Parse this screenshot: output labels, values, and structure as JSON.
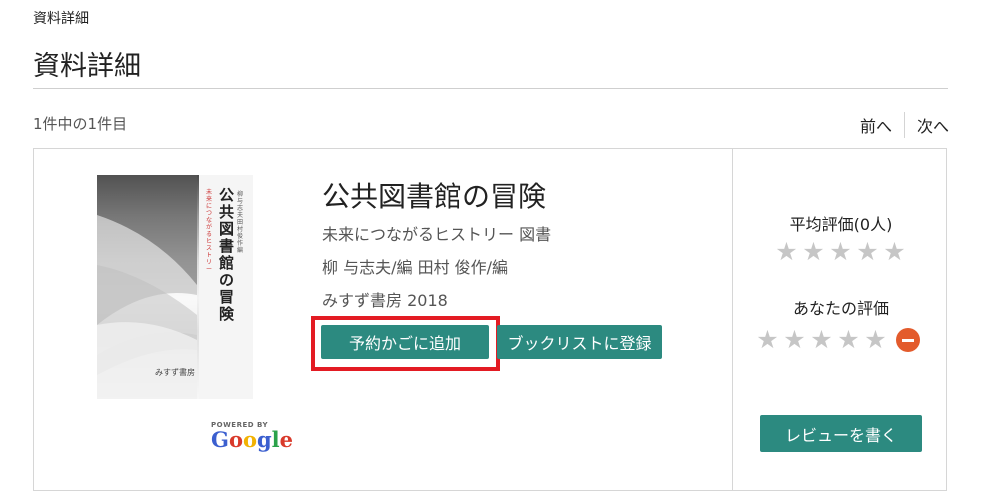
{
  "header": {
    "breadcrumb": "資料詳細",
    "title": "資料詳細"
  },
  "results": {
    "count_text": "1件中の1件目",
    "prev_label": "前へ",
    "next_label": "次へ"
  },
  "book": {
    "title": "公共図書館の冒険",
    "subtitle": "未来につながるヒストリー  図書",
    "authors": "柳 与志夫∕編  田村 俊作∕編",
    "publisher_year": "みすず書房  2018",
    "cover": {
      "title": "公共図書館の冒険",
      "subtitle": "未来につながるヒストリー",
      "editors": "柳与志夫 田村俊作 編",
      "publisher": "みすず書房"
    },
    "powered_by": "POWERED BY",
    "google_logo": {
      "letters": [
        "G",
        "o",
        "o",
        "g",
        "l",
        "e"
      ],
      "colors": [
        "#3b5fcf",
        "#d93a2b",
        "#f2b203",
        "#3b5fcf",
        "#2aa24a",
        "#d93a2b"
      ]
    }
  },
  "actions": {
    "reserve_label": "予約かごに追加",
    "booklist_label": "ブックリストに登録",
    "review_label": "レビューを書く"
  },
  "ratings": {
    "average_label": "平均評価(0人)",
    "average_stars": 0,
    "your_label": "あなたの評価",
    "your_stars": 0,
    "star_glyph": "★",
    "star_color": "#c6c6c6"
  },
  "colors": {
    "accent": "#2c8a80",
    "highlight": "#e31b23",
    "clear": "#e35b2c"
  }
}
